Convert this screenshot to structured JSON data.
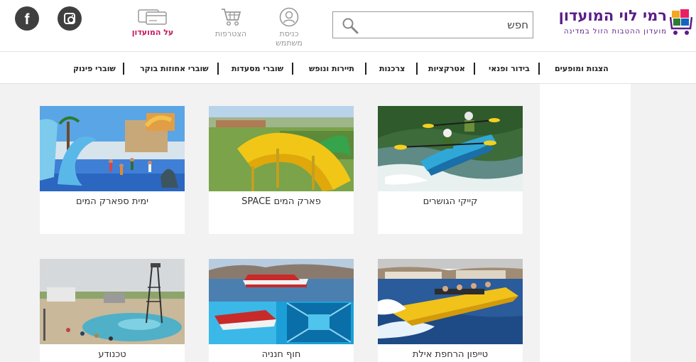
{
  "header": {
    "club_label": "על המועדון",
    "signup_label": "הצטרפות",
    "login_label_1": "כניסת",
    "login_label_2": "משתמש",
    "search_placeholder": "חפש",
    "logo_name": "רמי לוי המועדון",
    "logo_tagline": "מועדון ההטבות הזול במדינה"
  },
  "nav": {
    "items": [
      {
        "label": "הצגות ומופעים"
      },
      {
        "label": "בידור ופנאי"
      },
      {
        "label": "אטרקציות"
      },
      {
        "label": "צרכנות"
      },
      {
        "label": "תיירות ונופש"
      },
      {
        "label": "שוברי מסעדות"
      },
      {
        "label": "שוברי אחוזות בוקר"
      },
      {
        "label": "שוברי פינוק"
      }
    ]
  },
  "cards": [
    {
      "title": "ימית ספארק המים",
      "image": "water-park-dolphin-fountain"
    },
    {
      "title": "פארק המים SPACE",
      "image": "yellow-water-slide"
    },
    {
      "title": "קייקי הגושרים",
      "image": "kayak-river-rafting"
    },
    {
      "title": "טכנודע",
      "image": "science-park-pool"
    },
    {
      "title": "חוף חנניה",
      "image": "glass-bottom-boat"
    },
    {
      "title": "טייפון הרחפת אילת",
      "image": "speedboat-eilat"
    }
  ],
  "colors": {
    "brand_purple": "#5b1d87",
    "club_pink": "#c2185b",
    "muted_gray": "#999999",
    "page_bg": "#f2f2f2"
  }
}
